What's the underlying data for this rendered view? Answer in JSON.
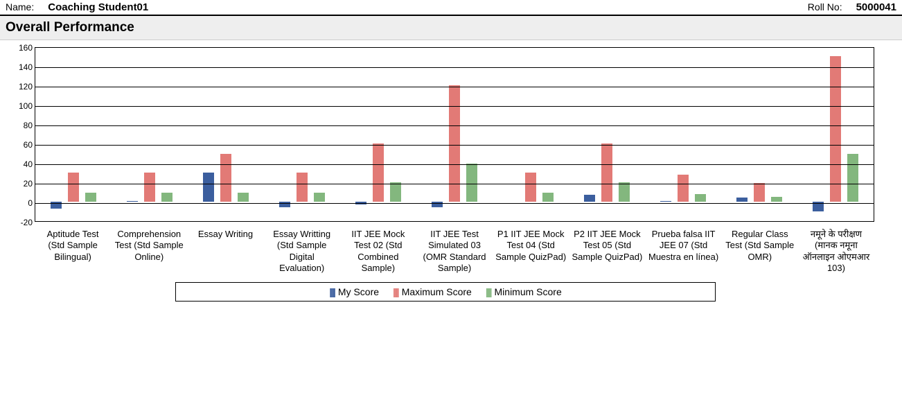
{
  "header": {
    "name_label": "Name:",
    "name_value": "Coaching Student01",
    "roll_label": "Roll No:",
    "roll_value": "5000041"
  },
  "section_title": "Overall Performance",
  "legend": {
    "my": "My Score",
    "max": "Maximum Score",
    "min": "Minimum Score"
  },
  "y_axis": {
    "min": -20,
    "max": 160,
    "step": 20,
    "ticks": [
      -20,
      0,
      20,
      40,
      60,
      80,
      100,
      120,
      140,
      160
    ]
  },
  "chart_data": {
    "type": "bar",
    "title": "Overall Performance",
    "xlabel": "",
    "ylabel": "",
    "ylim": [
      -20,
      160
    ],
    "categories": [
      "Aptitude Test (Std Sample Bilingual)",
      "Comprehension Test (Std Sample Online)",
      "Essay Writing",
      "Essay Writting (Std Sample Digital Evaluation)",
      "IIT JEE Mock Test 02 (Std Combined Sample)",
      "IIT JEE Test Simulated 03 (OMR Standard Sample)",
      "P1 IIT JEE Mock Test 04 (Std Sample QuizPad)",
      "P2 IIT JEE Mock Test 05 (Std Sample QuizPad)",
      "Prueba falsa IIT JEE 07 (Std Muestra en línea)",
      "Regular Class Test (Std Sample OMR)",
      "नमूने के परीक्षण (मानक नमूना ऑनलाइन ओएमआर 103)"
    ],
    "series": [
      {
        "name": "My Score",
        "values": [
          -7,
          1,
          30,
          -6,
          -3,
          -6,
          0,
          7,
          1,
          4,
          -10
        ]
      },
      {
        "name": "Maximum Score",
        "values": [
          30,
          30,
          49,
          30,
          60,
          120,
          30,
          60,
          28,
          19,
          150
        ]
      },
      {
        "name": "Minimum Score",
        "values": [
          9,
          9,
          9,
          9,
          20,
          39,
          9,
          20,
          8,
          5,
          49
        ]
      }
    ]
  }
}
